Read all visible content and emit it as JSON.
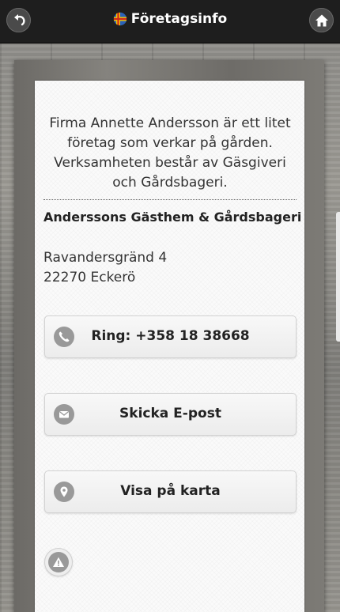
{
  "header": {
    "title": "Företagsinfo",
    "back_icon": "back-arrow-icon",
    "home_icon": "home-icon",
    "flag_icon": "aland-flag-icon"
  },
  "intro": {
    "lines": [
      "Firma Annette Andersson är ett litet",
      "företag som verkar på gården.",
      "Verksamheten består av Gäsgiveri",
      "och Gårdsbageri."
    ]
  },
  "company": {
    "name": "Anderssons Gästhem & Gårdsbageri",
    "address_line1": "Ravandersgränd 4",
    "address_line2": "22270 Eckerö"
  },
  "actions": {
    "call_label": "Ring: +358 18 38668",
    "email_label": "Skicka E-post",
    "map_label": "Visa på karta",
    "call_icon": "phone-icon",
    "email_icon": "envelope-icon",
    "map_icon": "map-pin-icon",
    "report_icon": "warning-icon"
  },
  "colors": {
    "header_bg": "#1e1e1e",
    "card_bg": "#fafafa",
    "icon_gray": "#999999"
  }
}
